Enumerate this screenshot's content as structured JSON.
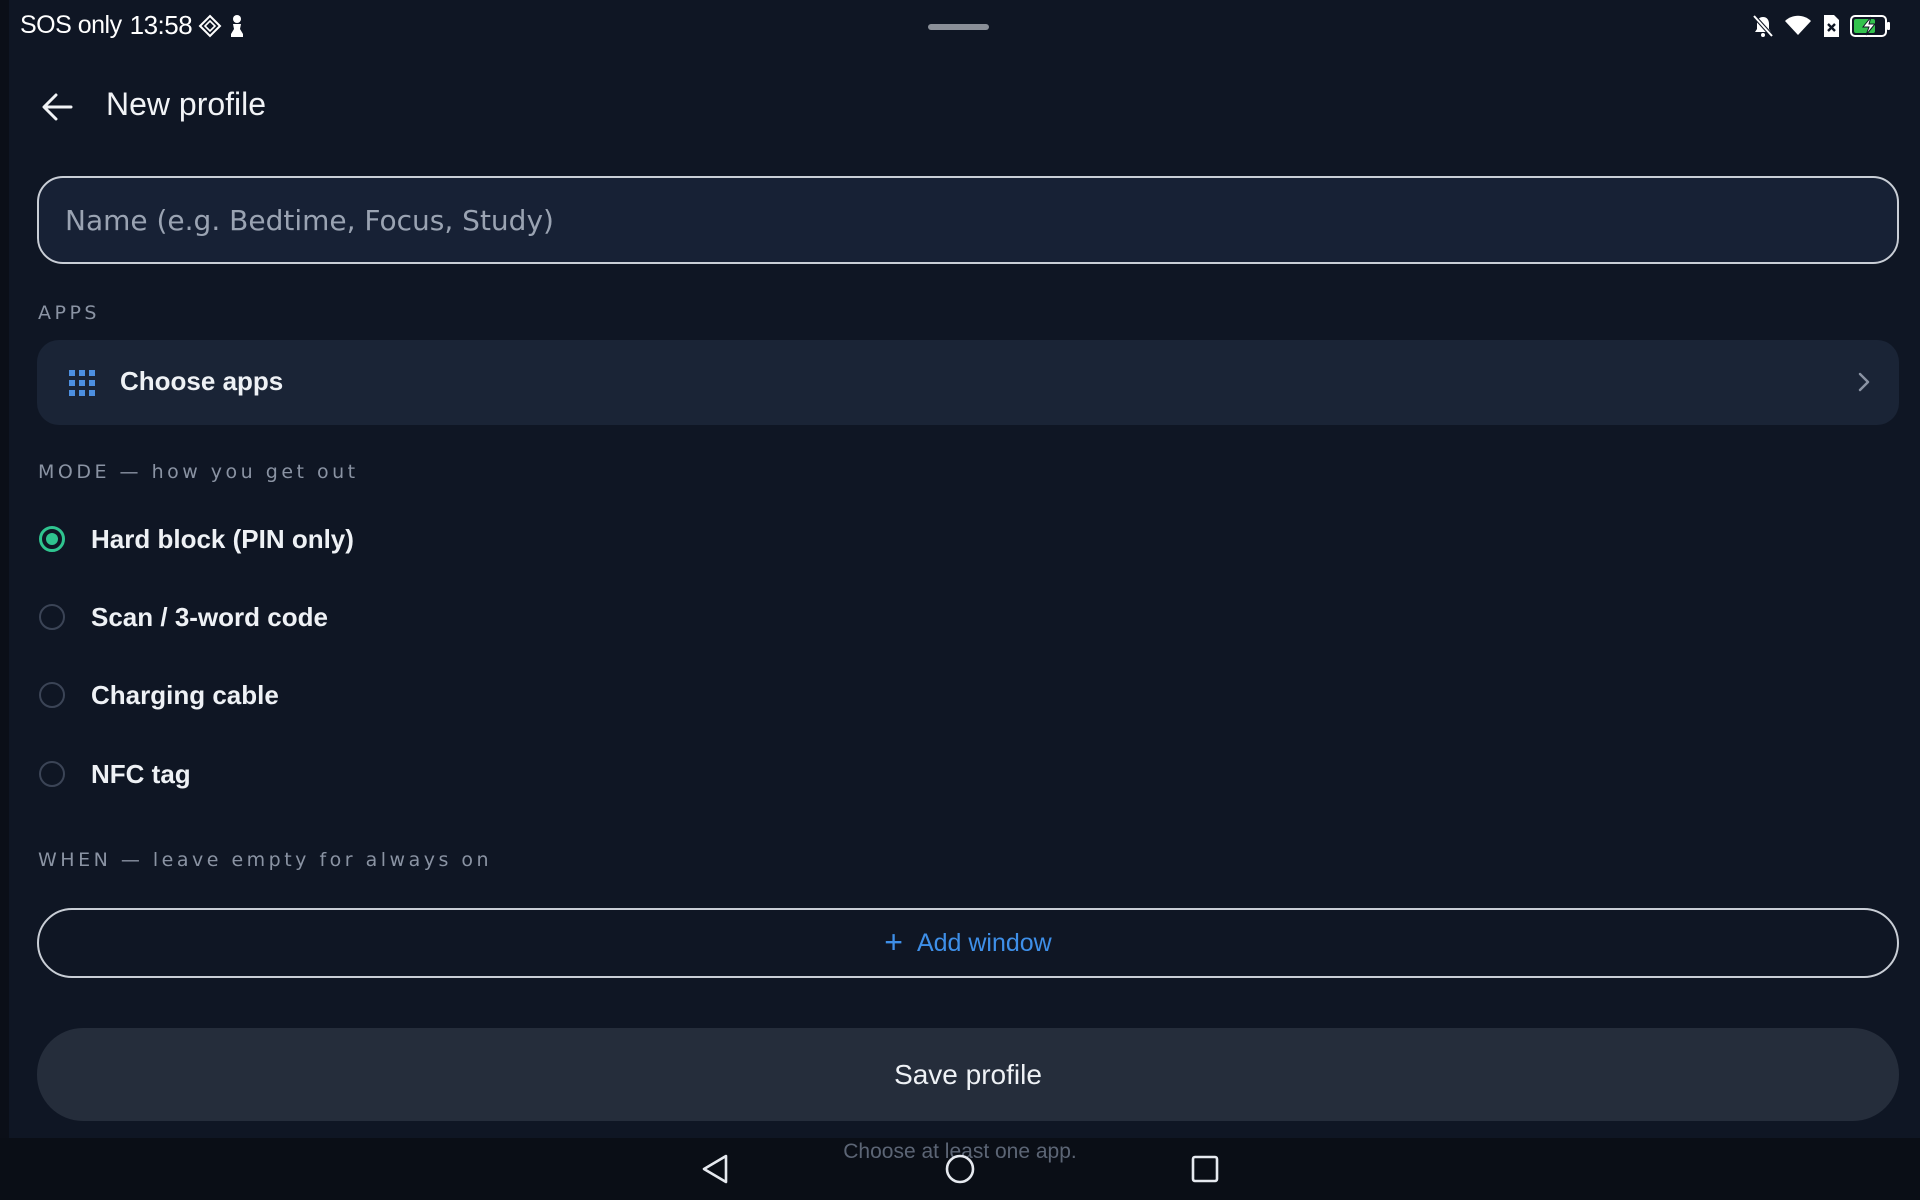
{
  "status_bar": {
    "carrier": "SOS only",
    "time": "13:58"
  },
  "header": {
    "title": "New profile"
  },
  "name_field": {
    "placeholder": "Name (e.g. Bedtime, Focus, Study)",
    "value": ""
  },
  "apps_section": {
    "label": "APPS",
    "choose_label": "Choose apps"
  },
  "mode_section": {
    "label": "MODE — how you get out",
    "options": [
      {
        "label": "Hard block (PIN only)",
        "selected": true
      },
      {
        "label": "Scan / 3-word code",
        "selected": false
      },
      {
        "label": "Charging cable",
        "selected": false
      },
      {
        "label": "NFC tag",
        "selected": false
      }
    ]
  },
  "when_section": {
    "label": "WHEN — leave empty for always on",
    "add_label": "Add window"
  },
  "save_label": "Save profile",
  "hint": "Choose at least one app.",
  "colors": {
    "background": "#0f1624",
    "accent_blue": "#3e8fe8",
    "radio_selected": "#2fc48f",
    "battery": "#33c24d"
  }
}
